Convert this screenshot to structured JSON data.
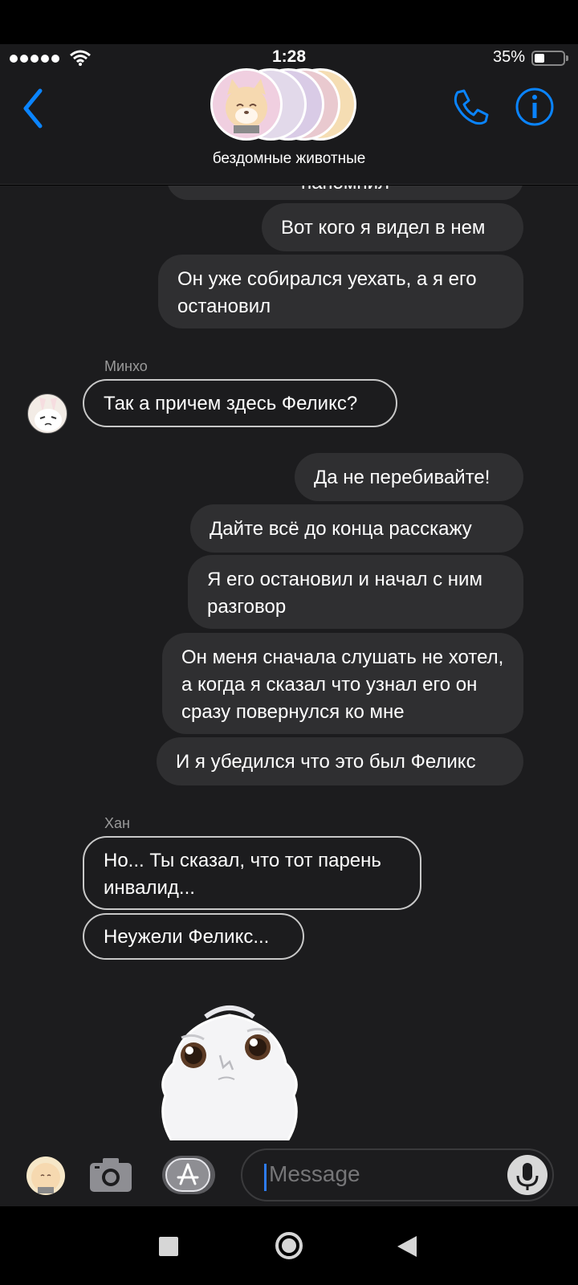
{
  "status_bar": {
    "time": "1:28",
    "battery": "35%",
    "battery_level": 0.35
  },
  "header": {
    "group_name": "бездомные животные"
  },
  "messages": {
    "m0": "напомнил",
    "m1": "Вот кого я видел в нем",
    "m2": "Он уже собирался уехать, а я его остановил",
    "sender_minho": "Минхо",
    "m3": "Так а причем здесь Феликс?",
    "m4": "Да не перебивайте!",
    "m5": "Дайте всё до конца расскажу",
    "m6": "Я его остановил и начал с ним разговор",
    "m7": "Он меня сначала слушать не хотел, а когда я сказал что узнал его он сразу повернулся ко мне",
    "m8": "И я убедился что это был Феликс",
    "sender_han": "Хан",
    "m9": "Но... Ты сказал, что тот парень инвалид...",
    "m10": "Неужели Феликс..."
  },
  "input": {
    "placeholder": "Message"
  },
  "colors": {
    "accent": "#0a84ff",
    "bubble_out": "#2f2f31",
    "background": "#1c1c1e"
  },
  "icons": [
    "back-chevron-icon",
    "phone-icon",
    "info-icon",
    "camera-icon",
    "app-store-icon",
    "mic-icon",
    "nav-square-icon",
    "nav-home-icon",
    "nav-back-icon"
  ]
}
